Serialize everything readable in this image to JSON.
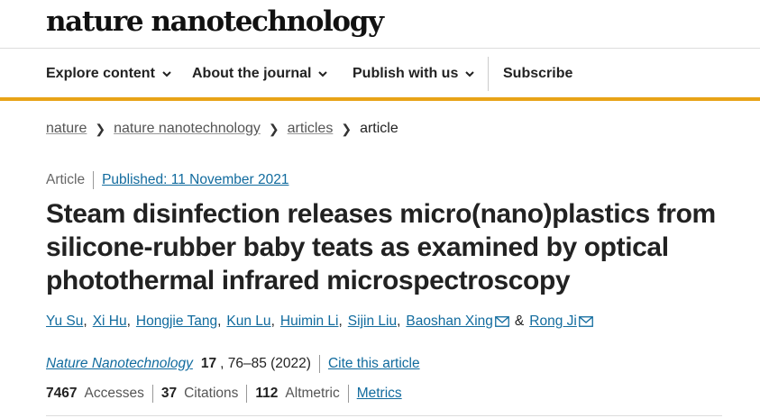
{
  "site": {
    "logo": "nature nanotechnology"
  },
  "nav": {
    "items": [
      {
        "label": "Explore content",
        "icon": "chevron-down-icon"
      },
      {
        "label": "About the journal",
        "icon": "chevron-down-icon"
      },
      {
        "label": "Publish with us",
        "icon": "chevron-down-icon"
      }
    ],
    "subscribe": "Subscribe"
  },
  "colors": {
    "accent": "#e8a317",
    "link": "#116b9e",
    "text": "#222222"
  },
  "breadcrumb": {
    "items": [
      "nature",
      "nature nanotechnology",
      "articles"
    ],
    "current": "article"
  },
  "article": {
    "type": "Article",
    "published": "Published: 11 November 2021",
    "title": "Steam disinfection releases micro(nano)plastics from silicone-rubber baby teats as examined by optical photothermal infrared microspectroscopy",
    "authors": [
      "Yu Su",
      "Xi Hu",
      "Hongjie Tang",
      "Kun Lu",
      "Huimin Li",
      "Sijin Liu",
      "Baoshan Xing",
      "Rong Ji"
    ],
    "author_and": "&",
    "journal": "Nature Nanotechnology",
    "volume": "17",
    "pages": ", 76–85 (2022)",
    "cite": "Cite this article"
  },
  "metrics": {
    "accesses_count": "7467",
    "accesses_label": "Accesses",
    "citations_count": "37",
    "citations_label": "Citations",
    "altmetric_count": "112",
    "altmetric_label": "Altmetric",
    "metrics_link": "Metrics"
  }
}
